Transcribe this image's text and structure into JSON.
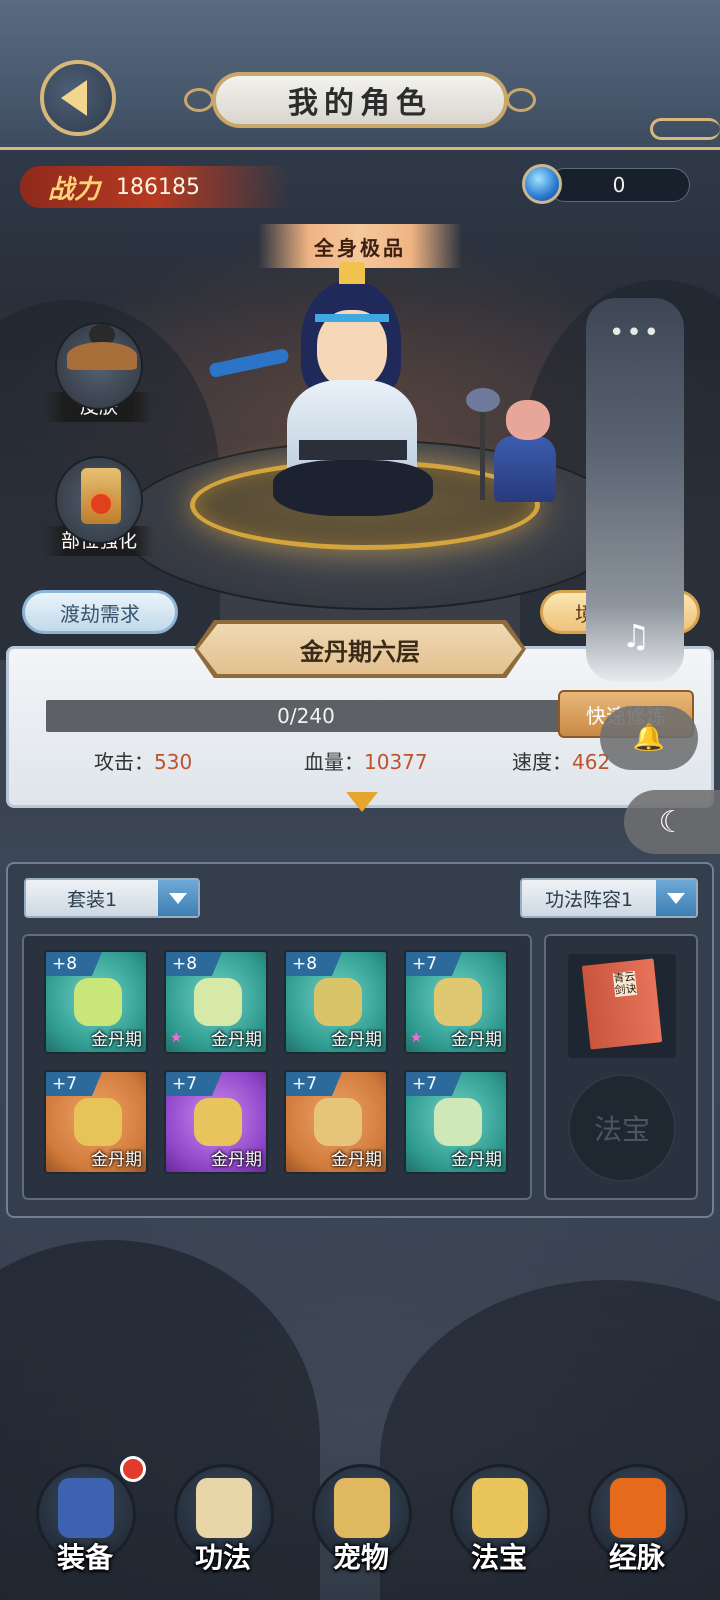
{
  "header": {
    "title": "我的角色"
  },
  "power": {
    "label": "战力",
    "value": "186185"
  },
  "currency": {
    "value": "0"
  },
  "hero": {
    "quality_badge": "全身极品"
  },
  "side_buttons": {
    "skin": "皮肤",
    "enhance": "部位强化"
  },
  "buttons": {
    "tribulation": "渡劫需求",
    "realm_short": "境"
  },
  "realm": {
    "name": "金丹期六层",
    "exp_text": "0/240",
    "exp_progress": 0,
    "quick_label": "快速修炼",
    "stats": [
      {
        "label": "攻击：",
        "value": "530"
      },
      {
        "label": "血量：",
        "value": "10377"
      },
      {
        "label": "速度：",
        "value": "462"
      }
    ]
  },
  "equipment": {
    "set_select": "套装1",
    "formation_select": "功法阵容1",
    "items": [
      {
        "level": "+8",
        "caption": "金丹期",
        "rarity": "teal",
        "star": false,
        "icon": "sword-icon"
      },
      {
        "level": "+8",
        "caption": "金丹期",
        "rarity": "teal",
        "star": true,
        "icon": "armor-icon"
      },
      {
        "level": "+8",
        "caption": "金丹期",
        "rarity": "teal",
        "star": false,
        "icon": "helmet-icon"
      },
      {
        "level": "+7",
        "caption": "金丹期",
        "rarity": "teal",
        "star": true,
        "icon": "boots-icon"
      },
      {
        "level": "+7",
        "caption": "金丹期",
        "rarity": "orange",
        "star": false,
        "icon": "necklace-icon"
      },
      {
        "level": "+7",
        "caption": "金丹期",
        "rarity": "purple",
        "star": false,
        "icon": "ring-icon"
      },
      {
        "level": "+7",
        "caption": "金丹期",
        "rarity": "orange",
        "star": false,
        "icon": "bracelet-icon"
      },
      {
        "level": "+7",
        "caption": "金丹期",
        "rarity": "teal",
        "star": false,
        "icon": "jade-icon"
      }
    ],
    "manual_book_title": "青云剑诀",
    "treasure_slot_label": "法宝"
  },
  "bottom_nav": [
    {
      "label": "装备",
      "icon": "equipment-icon",
      "badge": true
    },
    {
      "label": "功法",
      "icon": "scroll-icon",
      "badge": false
    },
    {
      "label": "宠物",
      "icon": "pet-icon",
      "badge": false
    },
    {
      "label": "法宝",
      "icon": "treasure-icon",
      "badge": false
    },
    {
      "label": "经脉",
      "icon": "meridian-icon",
      "badge": false
    }
  ],
  "overlay": {
    "dots": "•••",
    "music_icon": "♫",
    "bell_icon": "🔔",
    "moon_icon": "☾"
  }
}
